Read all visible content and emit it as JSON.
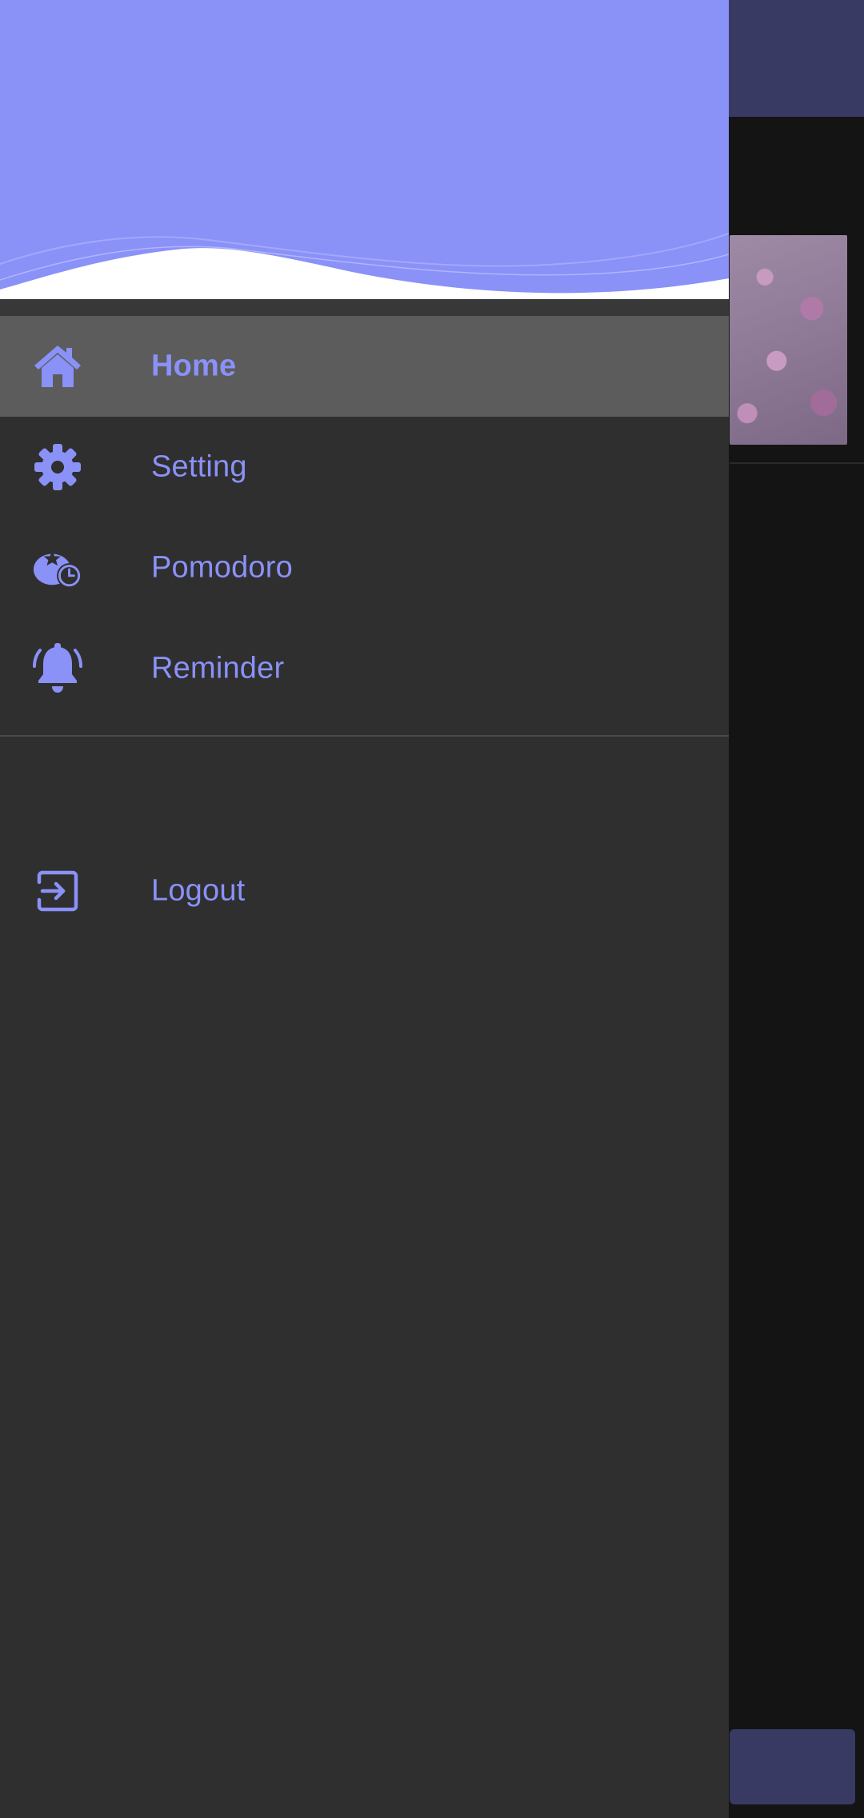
{
  "colors": {
    "accent": "#8a91f7",
    "drawer_background": "#2f2f2f",
    "active_item_background": "#5c5c5c",
    "header_wave": "#8a91f7",
    "app_bar": "#383a63"
  },
  "drawer": {
    "menu": [
      {
        "label": "Home",
        "icon": "home-icon",
        "active": true
      },
      {
        "label": "Setting",
        "icon": "gear-icon",
        "active": false
      },
      {
        "label": "Pomodoro",
        "icon": "tomato-timer-icon",
        "active": false
      },
      {
        "label": "Reminder",
        "icon": "bell-icon",
        "active": false
      }
    ],
    "logout": {
      "label": "Logout",
      "icon": "logout-icon"
    }
  }
}
